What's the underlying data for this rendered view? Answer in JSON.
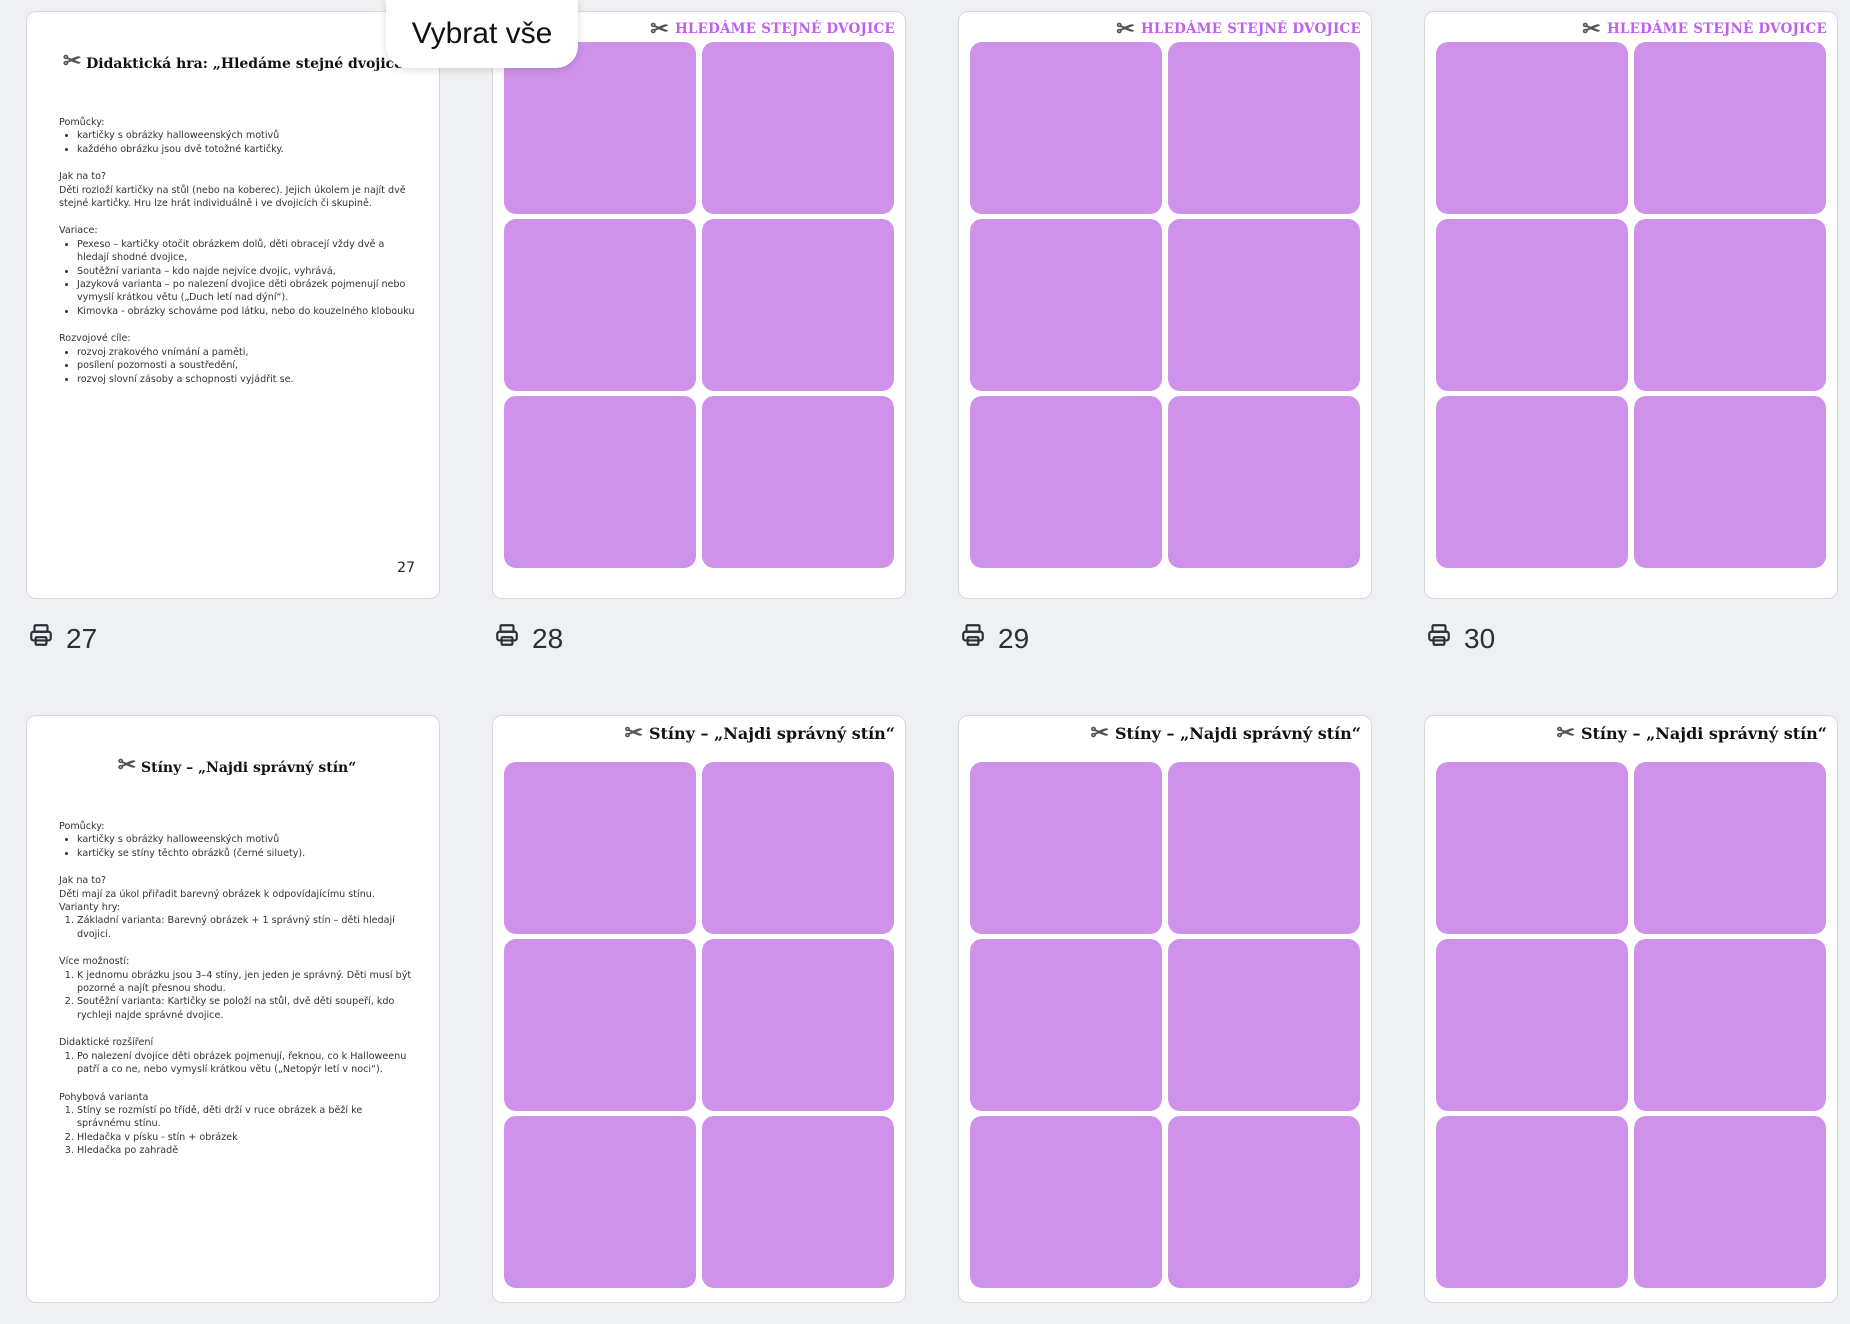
{
  "toolbar": {
    "select_all_label": "Vybrat vše"
  },
  "pages": [
    {
      "number": "27",
      "doc_title": "Didaktická hra: „Hledáme stejné dvojice“",
      "sections": [
        {
          "heading": "Pomůcky:",
          "list_type": "ul",
          "items": [
            "kartičky s obrázky halloweenských motivů",
            "každého obrázku jsou dvě totožné kartičky."
          ]
        },
        {
          "heading": "Jak na to?",
          "text": "Děti rozloží kartičky na stůl (nebo na koberec). Jejich úkolem je najít dvě stejné kartičky. Hru lze hrát individuálně i ve dvojicích či skupině."
        },
        {
          "heading": "Variace:",
          "list_type": "ul",
          "items": [
            "Pexeso – kartičky otočit obrázkem dolů, děti obracejí vždy dvě a hledají shodné dvojice,",
            "Soutěžní varianta – kdo najde nejvíce dvojic, vyhrává,",
            "Jazyková varianta – po nalezení dvojice děti obrázek pojmenují nebo vymyslí krátkou větu („Duch letí nad dýní“).",
            "Kimovka - obrázky schováme pod látku, nebo do kouzelného klobouku"
          ]
        },
        {
          "heading": "Rozvojové cíle:",
          "list_type": "ul",
          "items": [
            "rozvoj zrakového vnímání a paměti,",
            "posílení pozornosti a soustředění,",
            "rozvoj slovní zásoby a schopnosti vyjádřit se."
          ]
        }
      ],
      "footer_page": "27"
    },
    {
      "number": "28",
      "header": "HLEDÁME STEJNÉ DVOJICE",
      "cards": [
        "ghost-lavender-icon",
        "ghost-lavender-icon",
        "potion-bottle-icon",
        "potion-bottle-icon",
        "ghost-round-icon",
        "ghost-round-icon"
      ]
    },
    {
      "number": "29",
      "header": "HLEDÁME STEJNÉ DVOJICE",
      "cards": [
        "ghost-sheet-icon",
        "ghost-sheet-icon",
        "pumpkin-icon",
        "pumpkin-icon",
        "ghost-blush-icon",
        "ghost-blush-icon"
      ]
    },
    {
      "number": "30",
      "header": "HLEDÁME STEJNÉ DVOJICE",
      "cards": [
        "ghost-shy-icon",
        "ghost-shy-icon",
        "spider-icon",
        "spider-icon",
        "ghost-happy-icon",
        "ghost-happy-icon"
      ]
    },
    {
      "doc_title": "Stíny – „Najdi správný stín“",
      "sections": [
        {
          "heading": "Pomůcky:",
          "list_type": "ul",
          "items": [
            "kartičky s obrázky halloweenských motivů",
            "kartičky se stíny těchto obrázků (černé siluety)."
          ]
        },
        {
          "heading": "Jak na to?",
          "text": "Děti mají za úkol přiřadit barevný obrázek k odpovídajícímu stínu.",
          "subheading": "Varianty hry:",
          "list_type": "ol",
          "items": [
            "Základní varianta: Barevný obrázek + 1 správný stín – děti hledají dvojici."
          ]
        },
        {
          "heading": "Více možností:",
          "list_type": "ol",
          "items": [
            "K jednomu obrázku jsou 3–4 stíny, jen jeden je správný. Děti musí být pozorné a najít přesnou shodu.",
            "Soutěžní varianta: Kartičky se položí na stůl, dvě děti soupeří, kdo rychleji najde správné dvojice."
          ]
        },
        {
          "heading": "Didaktické rozšíření",
          "list_type": "ol",
          "items": [
            "Po nalezení dvojice děti obrázek pojmenují, řeknou, co k Halloweenu patří a co ne, nebo vymyslí krátkou větu („Netopýr letí v noci“)."
          ]
        },
        {
          "heading": "Pohybová varianta",
          "list_type": "ol",
          "items": [
            "Stíny se rozmístí po třídě, děti drží v ruce obrázek a běží ke správnému stínu.",
            "Hledačka v písku - stín + obrázek",
            "Hledačka po zahradě"
          ]
        }
      ]
    },
    {
      "header": "Stíny – „Najdi správný stín“",
      "cards": [
        "pumpkins-icon",
        "pumpkins-shadow-icon",
        "spiderweb-red-icon",
        "spiderweb-black-icon",
        "bat-icon",
        "bat-shadow-icon"
      ]
    },
    {
      "header": "Stíny – „Najdi správný stín“",
      "cards": [
        "ghost-wand-icon",
        "ghost-wand-shadow-icon",
        "ghost-pumpkin-icon",
        "ghost-pumpkin-shadow-icon",
        "ghost-bats-icon",
        "ghost-bats-shadow-icon"
      ]
    },
    {
      "header": "Stíny – „Najdi správný stín“",
      "cards": [
        "ghost-shy-icon",
        "ghost-shy-shadow-icon",
        "spider-icon",
        "spider-shadow-icon",
        "ghost-happy-icon",
        "ghost-happy-shadow-icon"
      ]
    }
  ],
  "colors": {
    "card_bg": "#cf92ea",
    "header_purple": "#c05ff0",
    "page_bg": "#eef0f3"
  }
}
